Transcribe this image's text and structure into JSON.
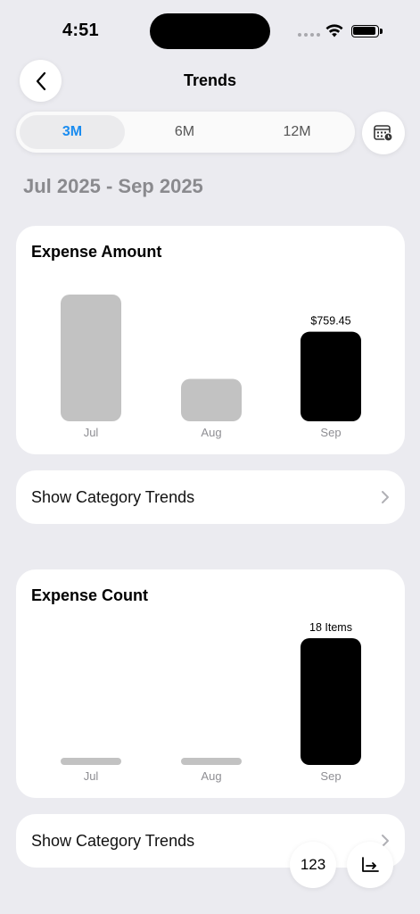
{
  "status_bar": {
    "time": "4:51"
  },
  "nav": {
    "title": "Trends"
  },
  "range_selector": {
    "options": [
      "3M",
      "6M",
      "12M"
    ],
    "selected": "3M",
    "accent_color": "#1a8cf0"
  },
  "date_range": "Jul 2025 - Sep 2025",
  "expense_amount": {
    "title": "Expense Amount",
    "row_label": "Show Category Trends"
  },
  "expense_count": {
    "title": "Expense Count",
    "row_label": "Show Category Trends"
  },
  "fab": {
    "label_123": "123",
    "chart_icon": "chart-axis-icon"
  },
  "chart_data": [
    {
      "type": "bar",
      "title": "Expense Amount",
      "categories": [
        "Jul",
        "Aug",
        "Sep"
      ],
      "values": [
        1075,
        360,
        759.45
      ],
      "highlight_index": 2,
      "highlight_label": "$759.45",
      "bar_color": "#c2c2c2",
      "highlight_color": "#000000"
    },
    {
      "type": "bar",
      "title": "Expense Count",
      "categories": [
        "Jul",
        "Aug",
        "Sep"
      ],
      "values": [
        0,
        0,
        18
      ],
      "highlight_index": 2,
      "highlight_label": "18 Items",
      "bar_color": "#c2c2c2",
      "highlight_color": "#000000"
    }
  ]
}
